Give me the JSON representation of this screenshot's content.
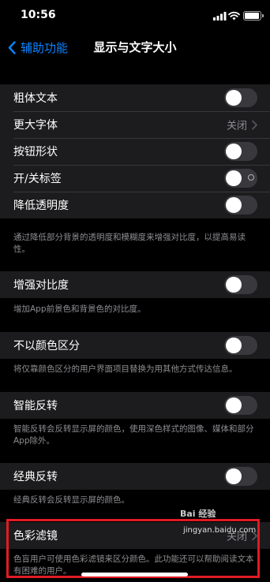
{
  "status_bar": {
    "time": "10:56"
  },
  "nav": {
    "back_label": "辅助功能",
    "title": "显示与文字大小"
  },
  "group1": {
    "rows": [
      {
        "label": "粗体文本"
      },
      {
        "label": "更大字体",
        "value": "关闭"
      },
      {
        "label": "按钮形状"
      },
      {
        "label": "开/关标签"
      },
      {
        "label": "降低透明度"
      }
    ],
    "footer": "通过降低部分背景的透明度和模糊度来增强对比度，以提高易读性。"
  },
  "group2": {
    "label": "增强对比度",
    "footer": "增加App前景色和背景色的对比度。"
  },
  "group3": {
    "label": "不以颜色区分",
    "footer": "将仅靠颜色区分的用户界面项目替换为用其他方式传达信息。"
  },
  "group4": {
    "label": "智能反转",
    "footer": "智能反转会反转显示屏的颜色，使用深色样式的图像、媒体和部分App除外。"
  },
  "group5": {
    "label": "经典反转",
    "footer": "经典反转会反转显示屏的颜色。"
  },
  "group6": {
    "label": "色彩滤镜",
    "value": "关闭",
    "footer": "色盲用户可使用色彩滤镜来区分颜色。此功能还可以帮助阅读文本有困难的用户。"
  },
  "watermark": {
    "logo": "Bai 经验",
    "url": "jingyan.baidu.com"
  },
  "colors": {
    "accent": "#0a84ff",
    "background": "#000000",
    "cell": "#1c1c1e",
    "highlight": "#e01b24"
  }
}
